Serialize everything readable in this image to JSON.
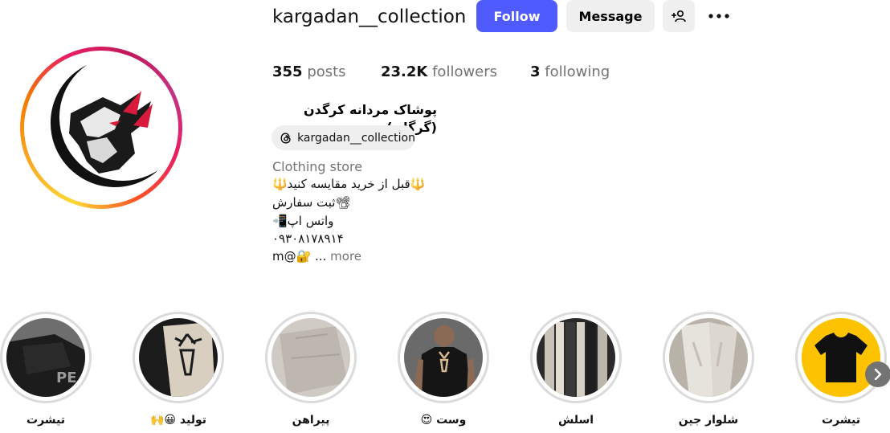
{
  "profile": {
    "username": "kargadan__collection",
    "full_name": "پوشاک مردانه کرگدن (گرگان)",
    "threads_handle": "kargadan__collection",
    "category": "Clothing store",
    "bio_lines": [
      "🔱قبل از خرید مقایسه کنید🔱",
      "📽ثبت سفارش",
      "واتس اپ📲",
      "۰۹۳۰۸۱۷۸۹۱۴"
    ],
    "bio_last_prefix": "m@🔐 ...",
    "bio_more_label": "more"
  },
  "buttons": {
    "follow": "Follow",
    "message": "Message"
  },
  "stats": {
    "posts_value": "355",
    "posts_label": "posts",
    "followers_value": "23.2K",
    "followers_label": "followers",
    "following_value": "3",
    "following_label": "following"
  },
  "highlights": [
    {
      "label": "تیشرت",
      "icon": "black-tshirt-closeup"
    },
    {
      "label": "تولید 😀🙌",
      "icon": "deer-print-shirt"
    },
    {
      "label": "پیراهن",
      "icon": "grey-shirt"
    },
    {
      "label": "وست 😍",
      "icon": "man-black-vest"
    },
    {
      "label": "اسلش",
      "icon": "pants-rack"
    },
    {
      "label": "شلوار جین",
      "icon": "light-jeans"
    },
    {
      "label": "تیشرت",
      "icon": "tshirt-icon-yellow"
    }
  ],
  "colors": {
    "follow_button": "#4f5bff",
    "secondary_button": "#efefef",
    "muted_text": "#737373"
  }
}
